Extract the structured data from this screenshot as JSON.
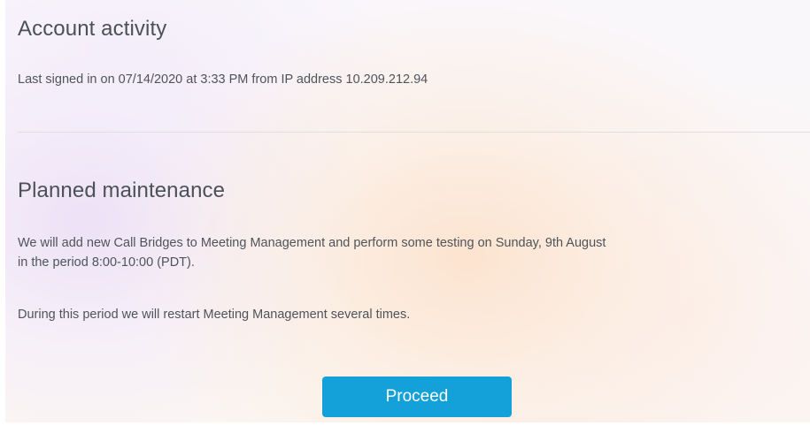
{
  "account_activity": {
    "title": "Account activity",
    "last_signed_in": "Last signed in on 07/14/2020 at 3:33 PM from IP address 10.209.212.94"
  },
  "planned_maintenance": {
    "title": "Planned maintenance",
    "notice_line_1": "We will add new Call Bridges to Meeting Management and perform some testing on Sunday, 9th August",
    "notice_line_2": "in the period 8:00-10:00 (PDT).",
    "restart_notice": "During this period we will restart Meeting Management several times."
  },
  "actions": {
    "proceed_label": "Proceed"
  },
  "colors": {
    "primary_button": "#14a0d8",
    "heading_text": "#4c5158",
    "body_text": "#4f545b"
  }
}
